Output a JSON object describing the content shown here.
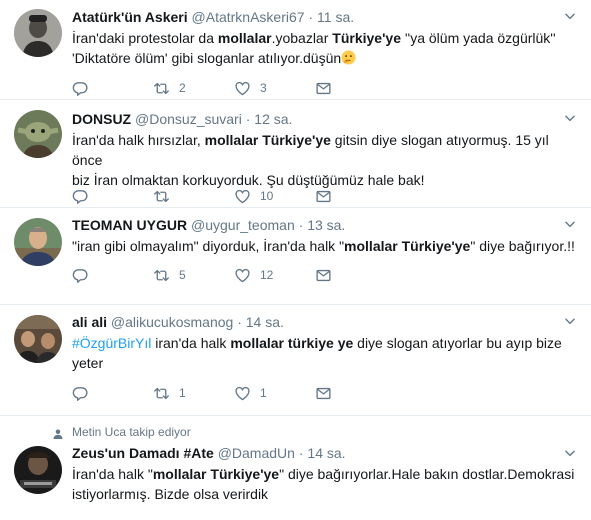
{
  "tweets": [
    {
      "name": "Atatürk'ün Askeri",
      "handle": "@AtatrknAskeri67",
      "time": "11 sa.",
      "text_parts": [
        "İran'daki protestolar da ",
        "mollalar",
        ".yobazlar ",
        "Türkiye'ye",
        " ''ya ölüm yada özgürlük''",
        "'Diktatöre ölüm' gibi sloganlar atılıyor.düşün"
      ],
      "emoji": "thinking-face",
      "replies": "",
      "retweets": "2",
      "likes": "3"
    },
    {
      "name": "DONSUZ",
      "handle": "@Donsuz_suvari",
      "time": "12 sa.",
      "text_parts": [
        "İran'da halk hırsızlar, ",
        "mollalar Türkiye'ye",
        " gitsin diye slogan atıyormuş. 15 yıl önce",
        "biz İran olmaktan korkuyorduk. Şu düştüğümüz hale bak!"
      ],
      "replies": "",
      "retweets": "",
      "likes": "10"
    },
    {
      "name": "TEOMAN UYGUR",
      "handle": "@uygur_teoman",
      "time": "13 sa.",
      "text_parts": [
        "\"iran gibi olmayalım\" diyorduk, İran'da halk \"",
        "mollalar Türkiye'ye",
        "\" diye bağırıyor.!!"
      ],
      "replies": "",
      "retweets": "5",
      "likes": "12"
    },
    {
      "name": "ali ali",
      "handle": "@alikucukosmanog",
      "time": "14 sa.",
      "text_parts": [
        "#ÖzgürBirYıl",
        " iran'da halk ",
        "mollalar türkiye ye",
        " diye slogan atıyorlar bu ayıp bize",
        "yeter"
      ],
      "replies": "",
      "retweets": "1",
      "likes": "1"
    },
    {
      "social_context": "Metin Uca takip ediyor",
      "name": "Zeus'un Damadı #Ate",
      "handle": "@DamadUn",
      "time": "14 sa.",
      "text_parts": [
        "İran'da halk \"",
        "mollalar Türkiye'ye",
        "\" diye bağırıyorlar.Hale bakın dostlar.Demokrasi",
        "istiyorlarmış. Bizde olsa verirdik"
      ]
    }
  ],
  "separator": "·",
  "icons": {
    "reply": "reply-icon",
    "retweet": "retweet-icon",
    "like": "heart-icon",
    "dm": "envelope-icon",
    "caret": "chevron-down-icon",
    "social": "person-icon"
  },
  "colors": {
    "text": "#14171a",
    "muted": "#657786",
    "link": "#1da1f2",
    "border": "#e6ecf0"
  }
}
